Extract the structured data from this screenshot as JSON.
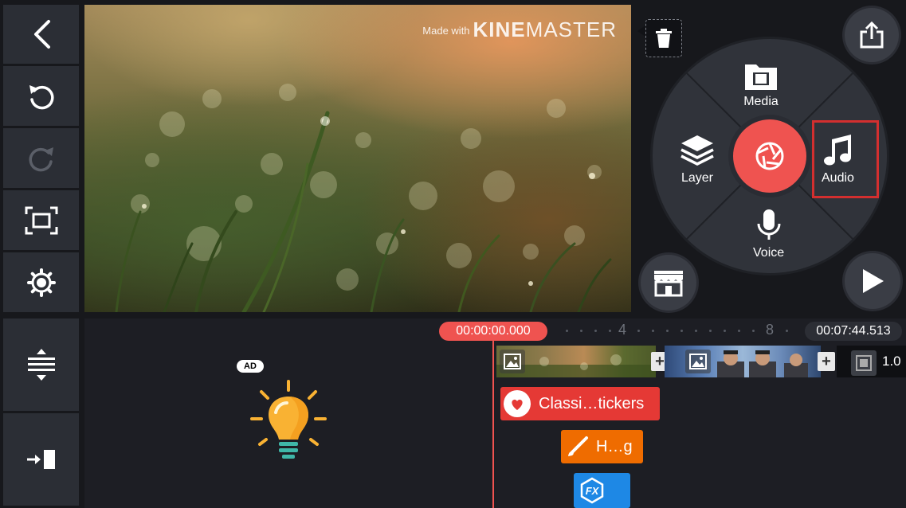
{
  "toolbar": {
    "buttons": [
      {
        "name": "back",
        "icon": "back-arrow-icon"
      },
      {
        "name": "undo",
        "icon": "undo-icon"
      },
      {
        "name": "redo",
        "icon": "redo-icon",
        "disabled": true
      },
      {
        "name": "fit",
        "icon": "aspect-fit-icon"
      },
      {
        "name": "settings",
        "icon": "gear-icon"
      },
      {
        "name": "timeline-height",
        "icon": "expand-vertical-icon"
      },
      {
        "name": "jump-to-end",
        "icon": "jump-end-icon"
      }
    ]
  },
  "preview": {
    "watermark_prefix": "Made with",
    "watermark_brand_bold": "KINE",
    "watermark_brand_light": "MASTER"
  },
  "media_wheel": {
    "media_label": "Media",
    "layer_label": "Layer",
    "audio_label": "Audio",
    "voice_label": "Voice",
    "highlighted_item": "audio",
    "record_color": "#ef5350",
    "highlight_color": "#d32f2f"
  },
  "actions": {
    "share_icon": "share-icon",
    "store_icon": "store-icon",
    "play_icon": "play-icon",
    "delete_icon": "trash-icon"
  },
  "timeline": {
    "current_time": "00:00:00.000",
    "total_duration": "00:07:44.513",
    "ruler_labels": [
      "4",
      "8"
    ],
    "end_value": "1.0",
    "layers": [
      {
        "type": "sticker",
        "label": "Classi…tickers",
        "color": "#e53935"
      },
      {
        "type": "handwriting",
        "label": "H…g",
        "color": "#ef6c00"
      },
      {
        "type": "effect",
        "label": "",
        "color": "#1e88e5"
      }
    ]
  },
  "ad": {
    "badge": "AD",
    "icon": "lightbulb-icon"
  }
}
